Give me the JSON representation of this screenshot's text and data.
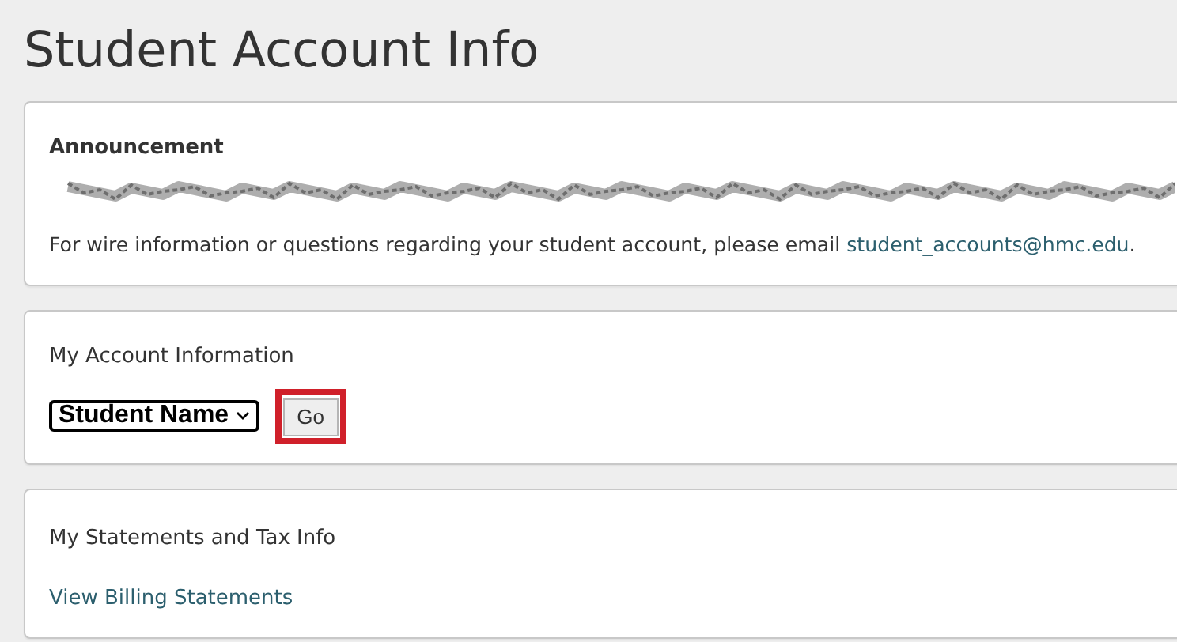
{
  "page_title": "Student Account Info",
  "announcement": {
    "heading": "Announcement",
    "text": "For wire information or questions regarding your student account, please email ",
    "email_link": "student_accounts@hmc.edu",
    "after_link": "."
  },
  "account": {
    "heading": "My Account Information",
    "select_value": "Student Name",
    "go_button": {
      "label": "Go",
      "highlighted": true
    }
  },
  "statements": {
    "heading": "My Statements and Tax Info",
    "link": "View Billing Statements"
  }
}
